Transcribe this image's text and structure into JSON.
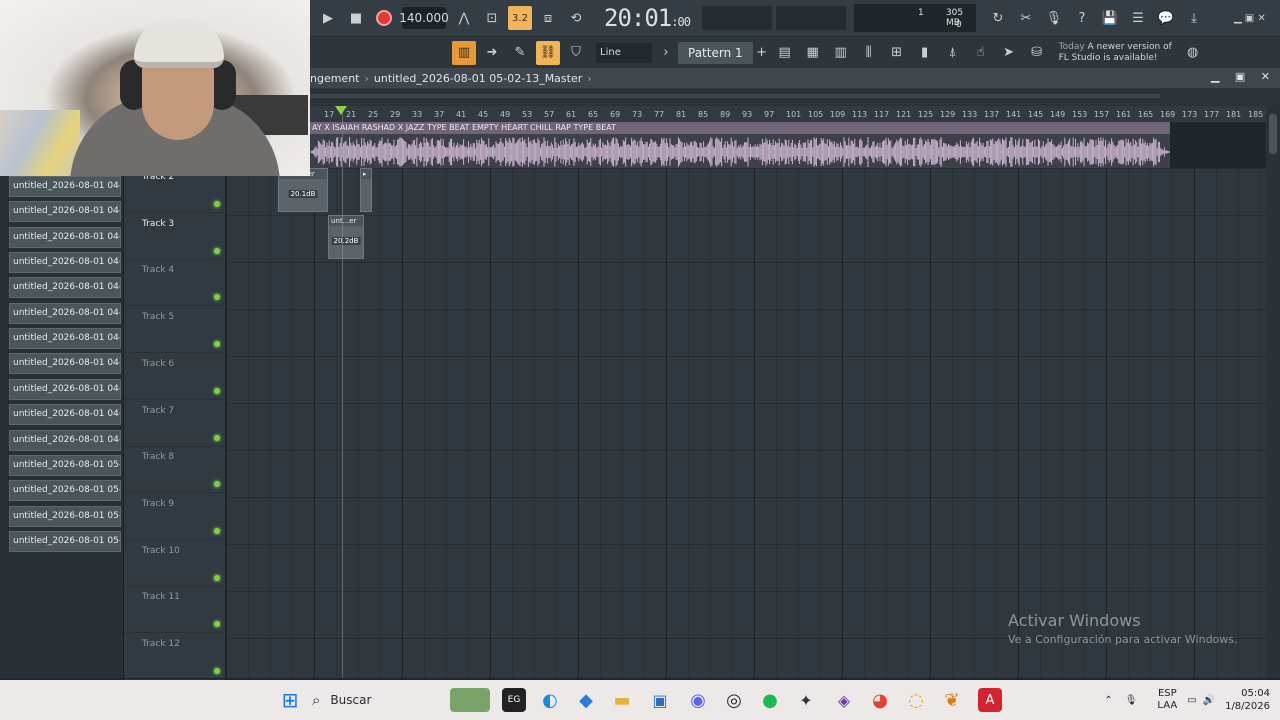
{
  "toolbar": {
    "tempo": "140.000",
    "time": "20:01",
    "time_sub": ":00",
    "beats_label": "3.2",
    "cpu_voices": "1",
    "cpu_mem": "305 MB",
    "cpu_poly": "0",
    "snap": "Line",
    "pattern": "Pattern 1",
    "news_date": "Today",
    "news_text": "A newer version of FL Studio is available!"
  },
  "breadcrumb": {
    "parent": "ngement",
    "current": "untitled_2026-08-01 05-02-13_Master"
  },
  "ruler": [
    "17",
    "21",
    "25",
    "29",
    "33",
    "37",
    "41",
    "45",
    "49",
    "53",
    "57",
    "61",
    "65",
    "69",
    "73",
    "77",
    "81",
    "85",
    "89",
    "93",
    "97",
    "101",
    "105",
    "109",
    "113",
    "117",
    "121",
    "125",
    "129",
    "133",
    "137",
    "141",
    "145",
    "149",
    "153",
    "157",
    "161",
    "165",
    "169",
    "173",
    "177",
    "181",
    "185"
  ],
  "audio_clip": {
    "title": "AY X ISAIAH RASHAD X JAZZ TYPE BEAT EMPTY HEART  CHILL RAP TYPE BEAT"
  },
  "browser": {
    "items": [
      "untitled_2026-08-01 04-...",
      "untitled_2026-08-01 04-...",
      "untitled_2026-08-01 04-...",
      "untitled_2026-08-01 04-...",
      "untitled_2026-08-01 04-...",
      "untitled_2026-08-01 04-...",
      "untitled_2026-08-01 04-...",
      "untitled_2026-08-01 04-...",
      "untitled_2026-08-01 04-...",
      "untitled_2026-08-01 04-...",
      "untitled_2026-08-01 04-...",
      "untitled_2026-08-01 05-...",
      "untitled_2026-08-01 05-...",
      "untitled_2026-08-01 05-...",
      "untitled_2026-08-01 05-..."
    ]
  },
  "tracks": [
    "Track 2",
    "Track 3",
    "Track 4",
    "Track 5",
    "Track 6",
    "Track 7",
    "Track 8",
    "Track 9",
    "Track 10",
    "Track 11",
    "Track 12"
  ],
  "clips": [
    {
      "title": "unti...ster",
      "db": "20.1dB"
    },
    {
      "title": "unt...er",
      "db": "20.2dB"
    }
  ],
  "watermark": {
    "title": "Activar Windows",
    "subtitle": "Ve a Configuración para activar Windows."
  },
  "taskbar": {
    "search_placeholder": "Buscar",
    "lang_top": "ESP",
    "lang_bottom": "LAA",
    "time": "05:04",
    "date": "1/8/2026"
  }
}
